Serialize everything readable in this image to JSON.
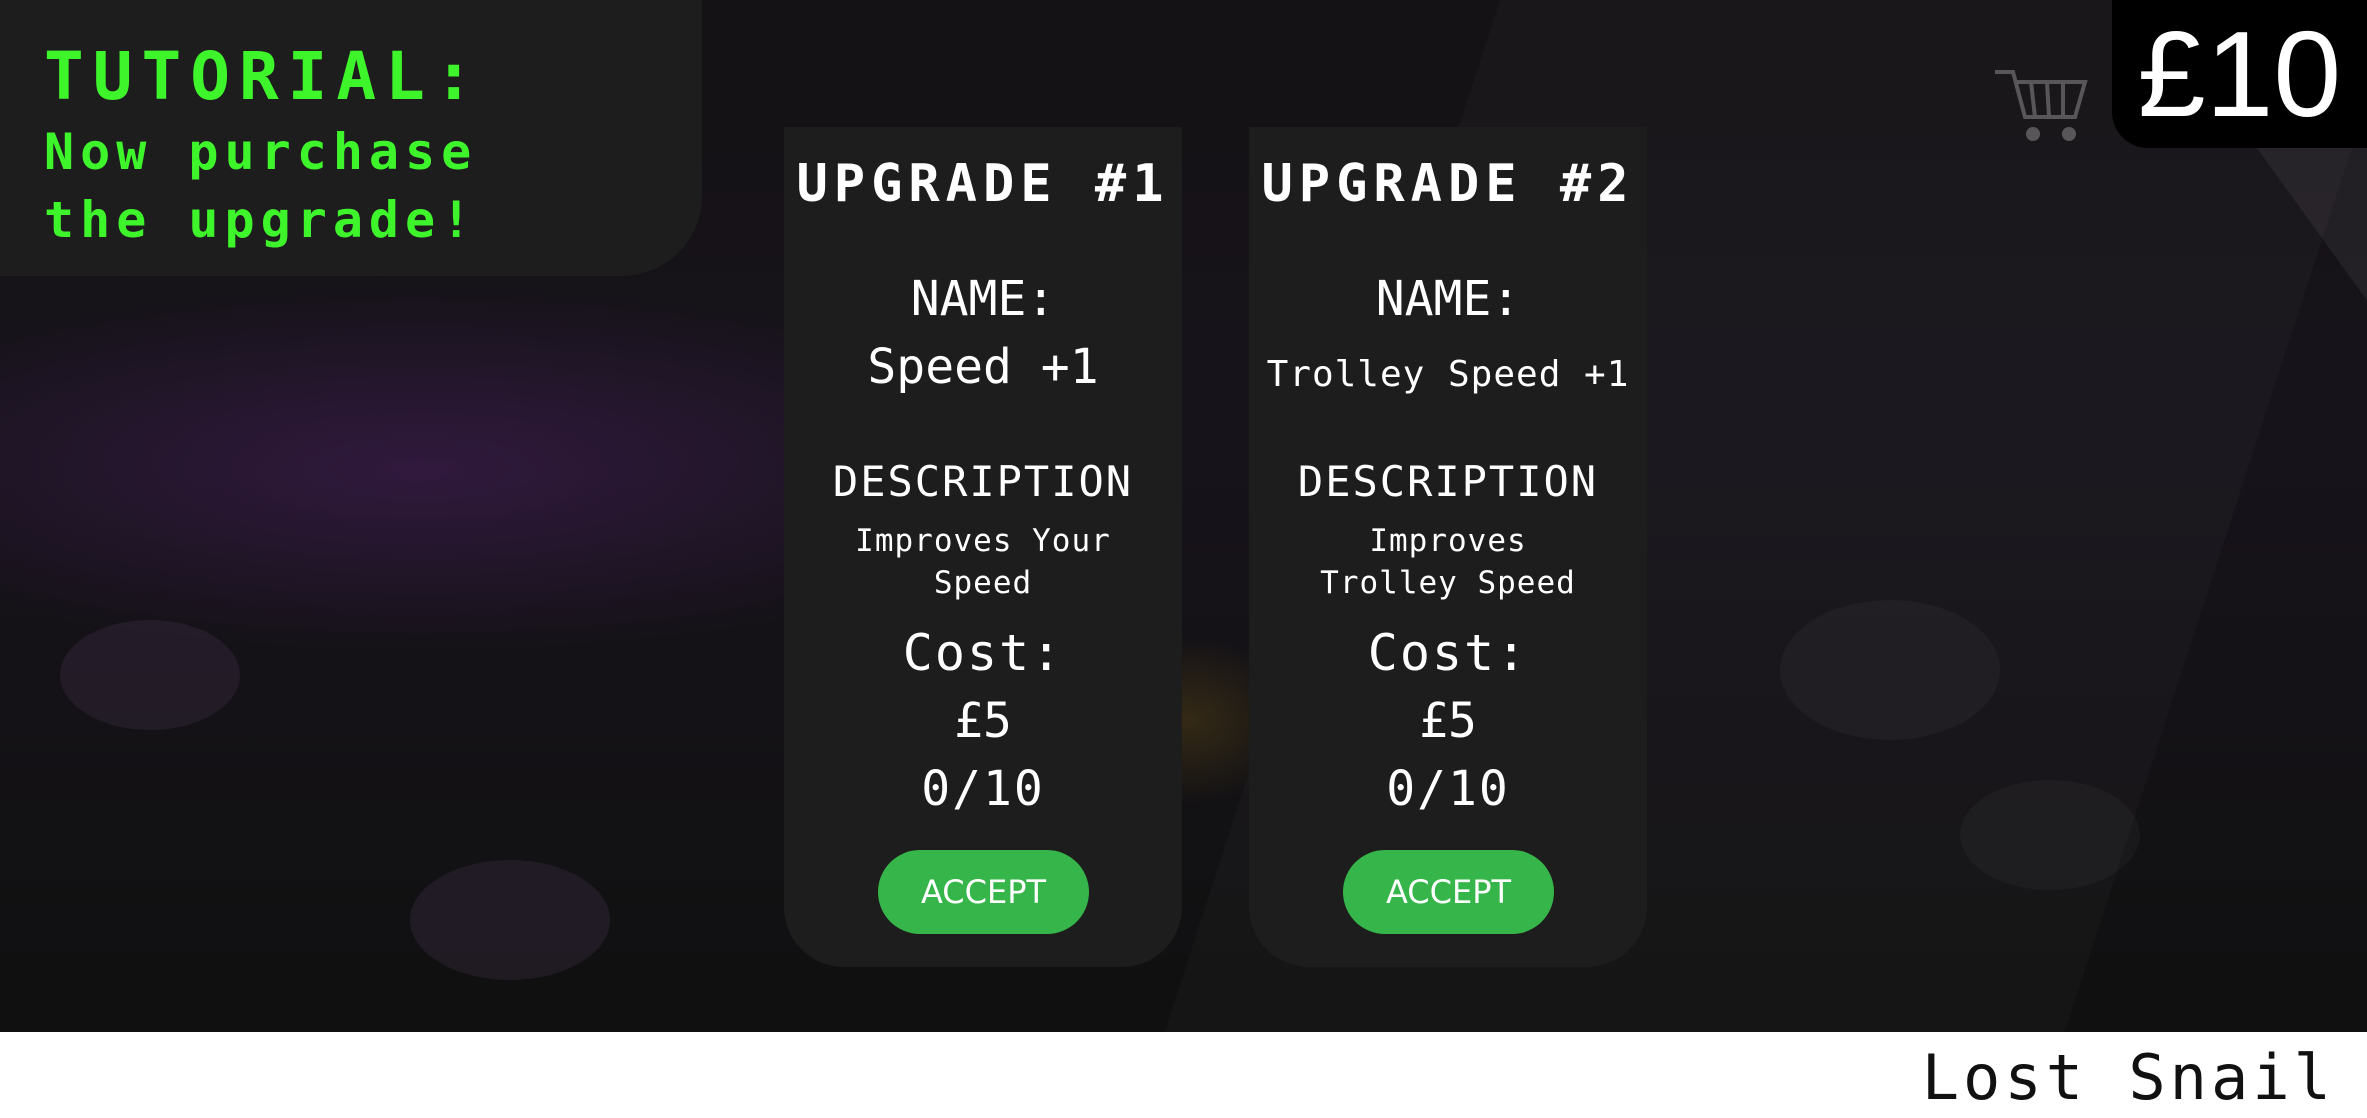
{
  "tutorial": {
    "title": "TUTORIAL:",
    "message": "Now purchase\nthe upgrade!"
  },
  "hud": {
    "money": "£10",
    "trolley_icon": "trolley-icon"
  },
  "upgrades": [
    {
      "title": "UPGRADE #1",
      "name_label": "NAME:",
      "name": "Speed +1",
      "description_label": "DESCRIPTION",
      "description": "Improves Your\nSpeed",
      "cost_label": "Cost:",
      "cost": "£5",
      "level": "0/10",
      "accept_label": "ACCEPT"
    },
    {
      "title": "UPGRADE #2",
      "name_label": "NAME:",
      "name": "Trolley Speed +1",
      "description_label": "DESCRIPTION",
      "description": "Improves\nTrolley Speed",
      "cost_label": "Cost:",
      "cost": "£5",
      "level": "0/10",
      "accept_label": "ACCEPT"
    }
  ],
  "footer": {
    "caption": "Lost Snail"
  },
  "colors": {
    "tutorial_text": "#3ef52b",
    "panel": "#1d1d1d",
    "accept_button": "#36b64a",
    "money_bg": "#000000"
  }
}
